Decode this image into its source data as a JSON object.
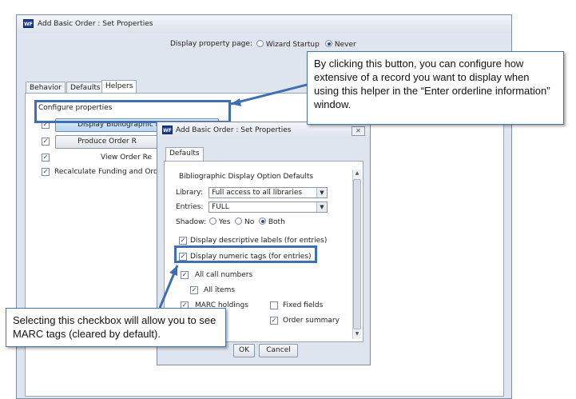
{
  "outer_window": {
    "icon": "WF",
    "title": "Add Basic Order : Set Properties",
    "display_property_page_label": "Display property page:",
    "radio_wizard_label": "Wizard Startup",
    "radio_never_label": "Never",
    "selected_radio": "Never",
    "tabs": [
      "Behavior",
      "Defaults",
      "Helpers"
    ],
    "active_tab": "Helpers",
    "configure_properties_label": "Configure properties",
    "helpers": [
      {
        "checked": true,
        "button": "Display Bibliographic Description"
      },
      {
        "checked": true,
        "button": "Produce Order R"
      },
      {
        "checked": true,
        "button": "View Order Re"
      },
      {
        "checked": true,
        "label": "Recalculate Funding and Orde"
      }
    ]
  },
  "inner_dialog": {
    "icon": "WF",
    "title": "Add Basic Order : Set Properties",
    "close_glyph": "✕",
    "tab": "Defaults",
    "group_label": "Bibliographic Display Option Defaults",
    "library_label": "Library:",
    "library_value": "Full access to all libraries",
    "entries_label": "Entries:",
    "entries_value": "FULL",
    "shadow_label": "Shadow:",
    "shadow_options": [
      "Yes",
      "No",
      "Both"
    ],
    "shadow_selected": "Both",
    "checkboxes": {
      "display_descriptive_labels": {
        "label": "Display descriptive labels (for entries)",
        "checked": true
      },
      "display_numeric_tags": {
        "label": "Display numeric tags (for entries)",
        "checked": true
      },
      "all_call_numbers": {
        "label": "All call numbers",
        "checked": true
      },
      "all_items": {
        "label": "All items",
        "checked": true
      },
      "marc_holdings": {
        "label": "MARC holdings",
        "checked": true
      },
      "fixed_fields": {
        "label": "Fixed fields",
        "checked": false
      },
      "order_summary": {
        "label": "Order summary",
        "checked": true
      }
    },
    "ok_label": "OK",
    "cancel_label": "Cancel"
  },
  "callouts": {
    "top": "By clicking this button, you can configure how extensive of a record you want to display when using this helper in the “Enter orderline information” window.",
    "bottom": "Selecting this checkbox will allow you to see MARC tags (cleared by default)."
  },
  "colors": {
    "highlight_border": "#3f6fb1",
    "window_bg": "#dfe5ee",
    "button_blue": "#b9d6f2"
  }
}
